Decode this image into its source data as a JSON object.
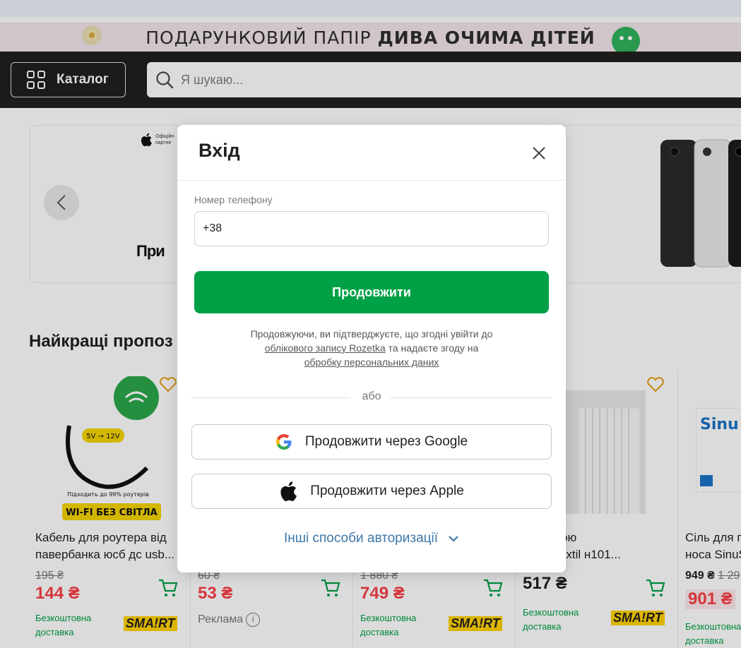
{
  "promo": {
    "text_plain": "ПОДАРУНКОВИЙ ПАПІР ",
    "text_bold": "ДИВА ОЧИМА ДІТЕЙ"
  },
  "header": {
    "catalog_label": "Каталог",
    "search_placeholder": "Я шукаю..."
  },
  "banner": {
    "apple_badge_line1": "Офіційн",
    "apple_badge_line2": "партне",
    "bank_partial": "При"
  },
  "section": {
    "title": "Найкращі пропоз"
  },
  "products": [
    {
      "title1": "Кабель для роутера від",
      "title2": "павербанка юсб дс usb...",
      "old_price": "195 ₴",
      "price": "144 ₴",
      "free1": "Безкоштовна",
      "free2": "доставка",
      "seller": "SMA!RT",
      "img_text1": "Підходить до 99% роутерів",
      "img_text2": "WI-FI БЕЗ СВІТЛА",
      "img_badge": "5V → 12V"
    },
    {
      "old_price": "60 ₴",
      "price": "53 ₴",
      "ad_label": "Реклама"
    },
    {
      "old_price": "1 880 ₴",
      "price": "749 ₴",
      "free1": "Безкоштовна",
      "free2": "доставка",
      "seller": "SMA!RT"
    },
    {
      "title1": "бантовою",
      "title2": "о VR-Textil н101...",
      "price": "517 ₴",
      "free1": "Безкоштовна",
      "free2": "доставка",
      "seller": "SMA!RT"
    },
    {
      "title1": "Сіль для п",
      "title2": "носа SinuS",
      "old_price": "949 ₴",
      "old_price2": "1 29",
      "price": "901 ₴",
      "free1": "Безкоштовна",
      "free2": "доставка"
    }
  ],
  "modal": {
    "title": "Вхід",
    "phone_label": "Номер телефону",
    "phone_value": "+38",
    "continue_label": "Продовжити",
    "consent_line1": "Продовжуючи, ви підтверджуєте, що згодні увійти до",
    "consent_link1": "облікового запису Rozetka",
    "consent_mid": " та надаєте згоду на",
    "consent_link2": "обробку персональних даних",
    "or_label": "або",
    "google_label": "Продовжити через Google",
    "apple_label": "Продовжити через Apple",
    "other_ways_label": "Інші способи авторизації"
  },
  "colors": {
    "brand_green": "#00a046",
    "header_dark": "#221f1f",
    "price_red": "#f84147",
    "link_blue": "#3e77aa"
  },
  "icons": [
    "grid-icon",
    "search-icon",
    "chevron-left-icon",
    "close-icon",
    "google-icon",
    "apple-icon",
    "chevron-down-icon",
    "cart-icon",
    "heart-icon",
    "info-icon"
  ]
}
